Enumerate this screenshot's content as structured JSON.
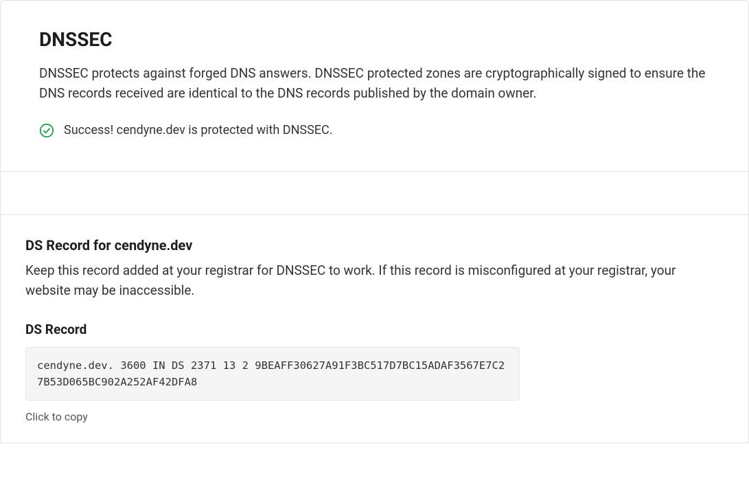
{
  "dnssec": {
    "title": "DNSSEC",
    "description": "DNSSEC protects against forged DNS answers. DNSSEC protected zones are cryptographically signed to ensure the DNS records received are identical to the DNS records published by the domain owner.",
    "success_message": "Success! cendyne.dev is protected with DNSSEC."
  },
  "ds": {
    "heading": "DS Record for cendyne.dev",
    "description": "Keep this record added at your registrar for DNSSEC to work. If this record is misconfigured at your registrar, your website may be inaccessible.",
    "sub_heading": "DS Record",
    "record_value": "cendyne.dev. 3600 IN DS 2371 13 2 9BEAFF30627A91F3BC517D7BC15ADAF3567E7C27B53D065BC902A252AF42DFA8",
    "copy_hint": "Click to copy"
  }
}
